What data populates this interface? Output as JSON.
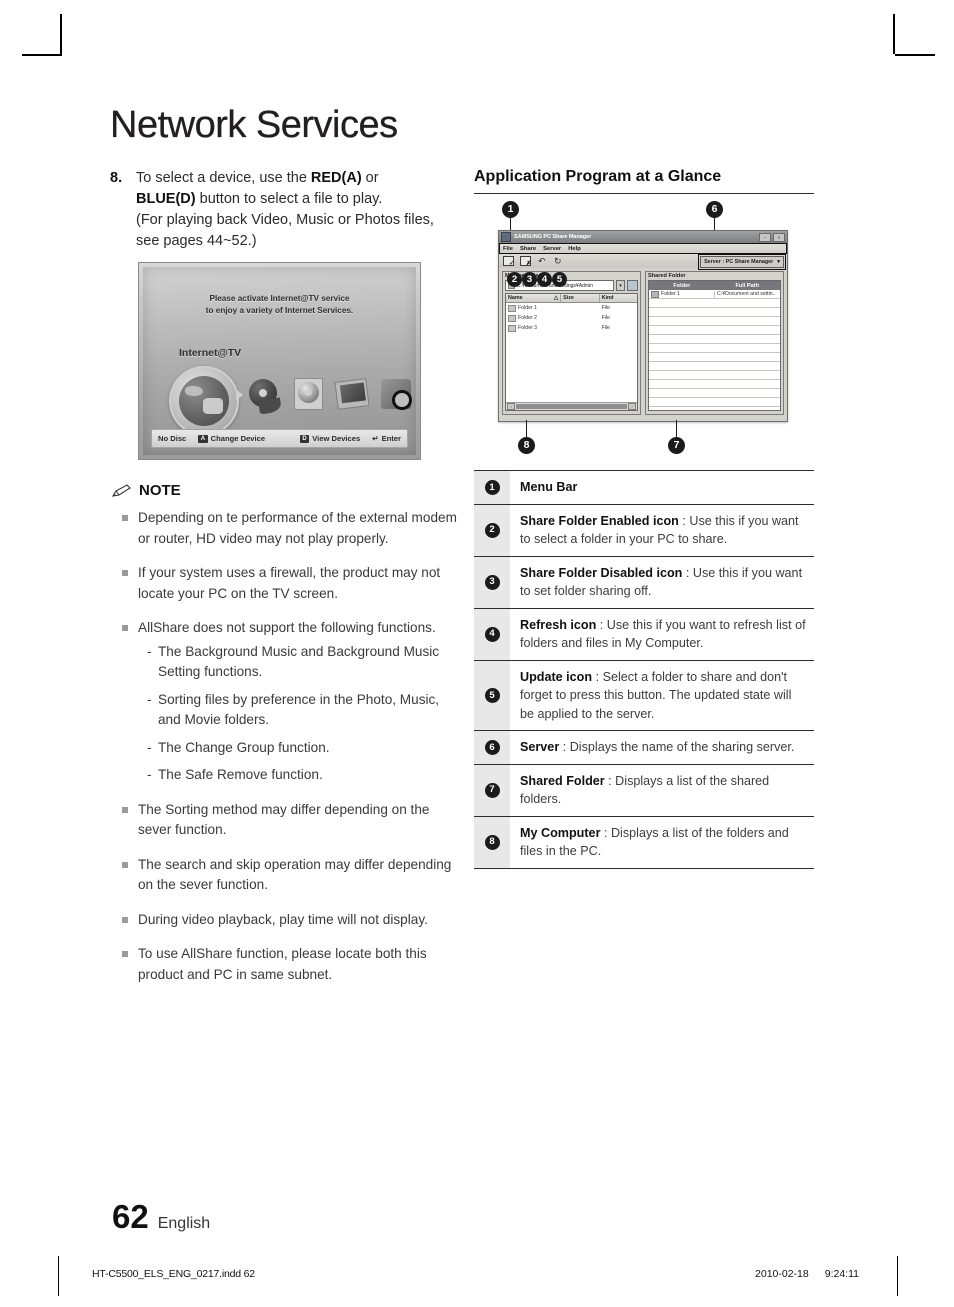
{
  "document": {
    "title": "Network Services",
    "page_number": "62",
    "language": "English",
    "footer_file": "HT-C5500_ELS_ENG_0217.indd   62",
    "footer_date": "2010-02-18",
    "footer_time": "9:24:11"
  },
  "step": {
    "number": "8.",
    "line1_pre": "To select a device, use the ",
    "line1_bold": "RED(A)",
    "line1_post": " or",
    "line2_bold": "BLUE(D)",
    "line2_post": " button to select a file to play.",
    "line3": "(For playing back Video, Music or Photos files,",
    "line4": "see pages 44~52.)"
  },
  "tv_screen": {
    "message_line1": "Please activate Internet@TV service",
    "message_line2": "to enjoy a variety of Internet Services.",
    "brand": "Internet@TV",
    "status_no_disc": "No Disc",
    "key_a": "A",
    "change_device": "Change Device",
    "key_d": "D",
    "view_devices": "View Devices",
    "enter_glyph": "↵",
    "enter": "Enter"
  },
  "note": {
    "heading": "NOTE",
    "items": [
      {
        "text": "Depending on te performance of the external modem or router, HD video may not play properly.",
        "sub": []
      },
      {
        "text": "If your system uses a firewall, the product may not locate your PC on the TV screen.",
        "sub": []
      },
      {
        "text": "AllShare does not support the following functions.",
        "sub": [
          "The Background Music and Background Music Setting functions.",
          "Sorting files by preference in the Photo, Music, and Movie folders.",
          "The Change Group function.",
          "The Safe Remove function."
        ]
      },
      {
        "text": "The Sorting method may differ depending on the sever function.",
        "sub": []
      },
      {
        "text": "The search and skip operation may differ depending on the sever function.",
        "sub": []
      },
      {
        "text": "During video playback, play time will not display.",
        "sub": []
      },
      {
        "text": "To use AllShare function, please locate both this product and PC in same subnet.",
        "sub": []
      }
    ]
  },
  "right": {
    "section_title": "Application Program at a Glance"
  },
  "app_window": {
    "window_title": "SAMSUNG PC Share Manager",
    "minimize_glyph": "–",
    "close_glyph": "×",
    "menu": [
      "File",
      "Share",
      "Server",
      "Help"
    ],
    "server_label": "Server :  PC Share Manager",
    "server_caret": "▾",
    "my_computer": {
      "caption": "My Computer",
      "address": "C:¥Document and settings¥Admin",
      "dropdown_glyph": "▾",
      "columns": [
        "Name",
        "Size",
        "Kind"
      ],
      "sort_glyph": "△",
      "rows": [
        {
          "name": "Folder 1",
          "size": "",
          "kind": "File"
        },
        {
          "name": "Folder 2",
          "size": "",
          "kind": "File"
        },
        {
          "name": "Folder 3",
          "size": "",
          "kind": "File"
        }
      ],
      "scroll_left_glyph": "‹",
      "scroll_right_glyph": "›"
    },
    "shared_folder": {
      "caption": "Shared Folder",
      "columns": [
        "Folder",
        "Full Path"
      ],
      "rows": [
        {
          "folder": "Folder 1",
          "full_path": "C:¥Document and settin.."
        }
      ],
      "empty_row_count": 12
    }
  },
  "callouts": {
    "c1": "1",
    "c2": "2",
    "c3": "3",
    "c4": "4",
    "c5": "5",
    "c6": "6",
    "c7": "7",
    "c8": "8"
  },
  "legend": [
    {
      "num": "1",
      "bold": "Menu Bar",
      "rest": ""
    },
    {
      "num": "2",
      "bold": "Share Folder Enabled icon",
      "rest": " : Use this if you want to select a folder in your PC to share."
    },
    {
      "num": "3",
      "bold": "Share Folder Disabled icon",
      "rest": " : Use this if you want to set folder sharing off."
    },
    {
      "num": "4",
      "bold": "Refresh icon",
      "rest": " : Use this if you want to refresh list of folders and files in My Computer."
    },
    {
      "num": "5",
      "bold": "Update icon",
      "rest": " : Select a folder to share and don't forget to press this button. The updated state will be applied to the server."
    },
    {
      "num": "6",
      "bold": "Server",
      "rest": " : Displays the name of the sharing server."
    },
    {
      "num": "7",
      "bold": "Shared Folder",
      "rest": " : Displays a list of the shared folders."
    },
    {
      "num": "8",
      "bold": "My Computer",
      "rest": " : Displays a list of the folders and files in the PC."
    }
  ],
  "colors": {
    "ink": "#231f20",
    "body_text": "#3a3a3a",
    "legend_num_bg": "#e8e8e8",
    "callout_bg": "#1b1b1b"
  }
}
